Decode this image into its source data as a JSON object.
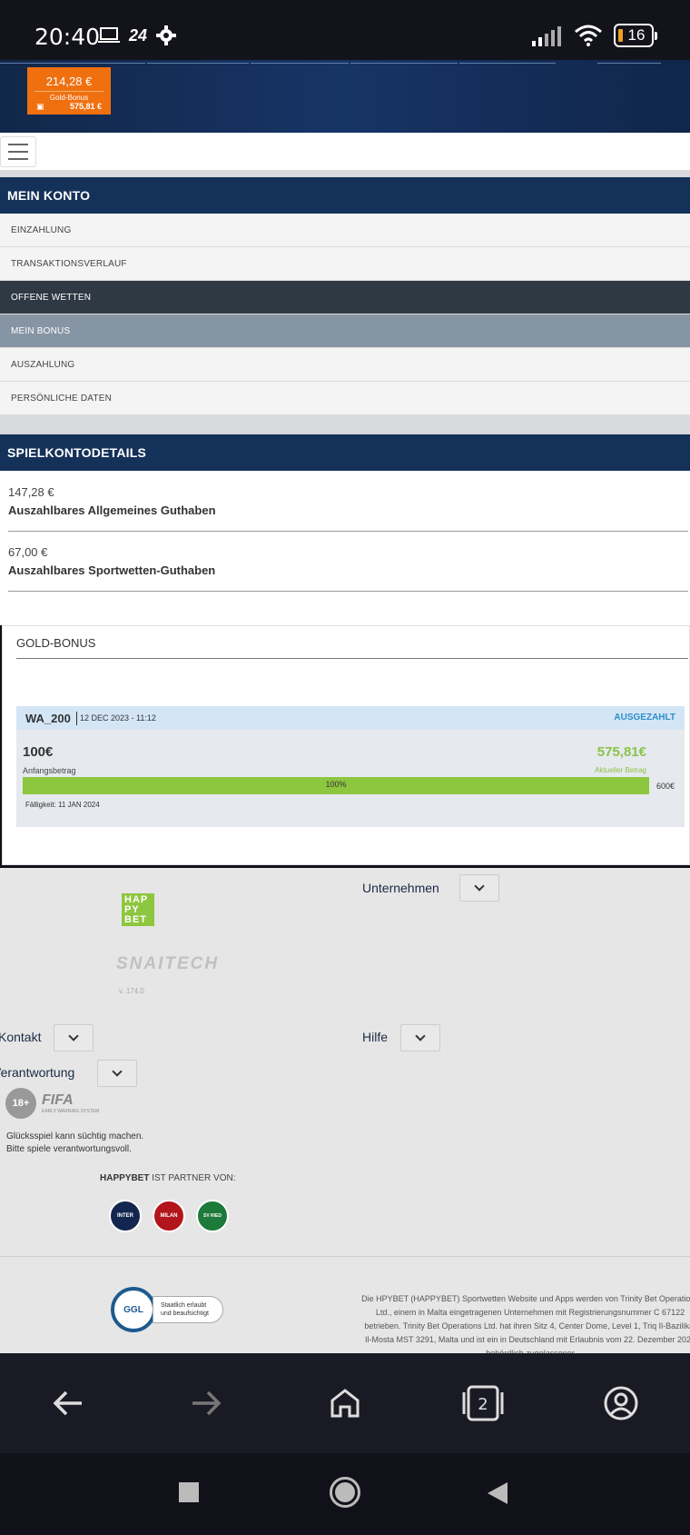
{
  "status_bar": {
    "time": "20:40",
    "app_badge": "24",
    "battery": "16"
  },
  "header": {
    "balance": "214,28 €",
    "gold_bonus_label": "Gold-Bonus",
    "gold_bonus_amount": "575,81 €"
  },
  "account_menu": {
    "title": "MEIN KONTO",
    "items": [
      {
        "label": "EINZAHLUNG"
      },
      {
        "label": "TRANSAKTIONSVERLAUF"
      },
      {
        "label": "OFFENE WETTEN"
      },
      {
        "label": "MEIN BONUS"
      },
      {
        "label": "AUSZAHLUNG"
      },
      {
        "label": "PERSÖNLICHE DATEN"
      }
    ]
  },
  "details": {
    "title": "SPIELKONTODETAILS",
    "rows": [
      {
        "amount": "147,28 €",
        "label": "Auszahlbares Allgemeines Guthaben"
      },
      {
        "amount": "67,00 €",
        "label": "Auszahlbares Sportwetten-Guthaben"
      }
    ]
  },
  "gold_bonus": {
    "title": "GOLD-BONUS",
    "code": "WA_200",
    "date": "12 DEC 2023 - 11:12",
    "status": "AUSGEZAHLT",
    "start_amount": "100€",
    "start_label": "Anfangsbetrag",
    "current_amount": "575,81€",
    "current_label": "Aktueller Betrag",
    "progress": 100,
    "progress_text": "100%",
    "max": "600€",
    "due": "Fälligkeit: 11 JAN 2024",
    "colors": {
      "progress": "#8dc63f",
      "status": "#2a90c8"
    }
  },
  "footer": {
    "logo_text": "HAPPYBET",
    "logo_lines": [
      "HAP",
      "PY",
      "BET"
    ],
    "snaitech": "SNAITECH",
    "version": "v. 174.0",
    "unternehmen": "Unternehmen",
    "kontakt": "Kontakt",
    "hilfe": "Hilfe",
    "verantwortung": "Verantwortung",
    "badge_18": "18+",
    "fifa": "FIFA",
    "fifa_sub": "EARLY WARNING SYSTEM",
    "gamble_line1": "Glücksspiel kann süchtig machen.",
    "gamble_line2": "Bitte spiele verantwortungsvoll.",
    "partner_brand": "HAPPYBET",
    "partner_text": " IST PARTNER VON:",
    "clubs": [
      "INTER",
      "MILAN",
      "SV RIED"
    ],
    "ggl_logo": "GGL",
    "ggl_text": "Staatlich erlaubt und beaufsichtigt",
    "legal": "Die HPYBET (HAPPYBET) Sportwetten Website und Apps werden von Trinity Bet Operations Ltd., einem in Malta eingetragenen Unternehmen mit Registrierungsnummer C 67122 betrieben. Trinity Bet Operations Ltd. hat ihren Sitz 4, Center Dome, Level 1, Triq Il-Bazilika, Il-Mosta MST 3291, Malta und ist ein in Deutschland mit Erlaubnis vom 22. Dezember 2022 behördlich zugelassener"
  },
  "browser_nav": {
    "tabs_count": "2"
  }
}
